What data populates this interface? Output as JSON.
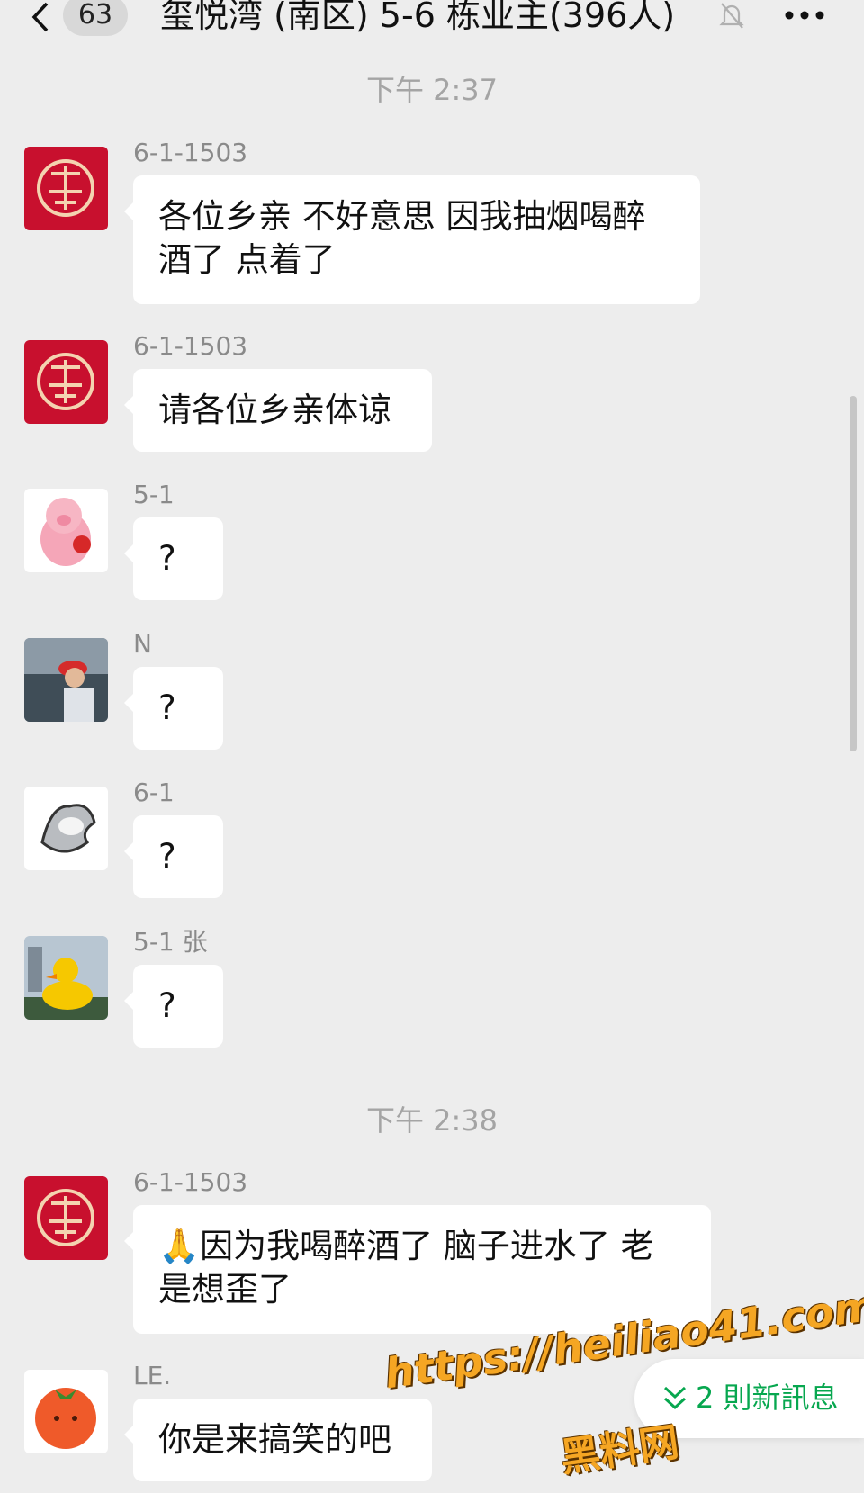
{
  "header": {
    "unread_count": "63",
    "title": "玺悦湾 (南区) 5-6 栋业主(396人)",
    "muted": true
  },
  "timestamps": [
    "下午 2:37",
    "下午 2:38"
  ],
  "messages": [
    {
      "sender": "6-1-1503",
      "text": "各位乡亲 不好意思 因我抽烟喝醉酒了 点着了",
      "avatar": "red-fu-avatar"
    },
    {
      "sender": "6-1-1503",
      "text": "请各位乡亲体谅",
      "avatar": "red-fu-avatar"
    },
    {
      "sender": "5-1",
      "text": "?",
      "avatar": "pink-pig-avatar"
    },
    {
      "sender": "N",
      "text": "?",
      "avatar": "person-red-cap-avatar"
    },
    {
      "sender": "6-1",
      "text": "?",
      "avatar": "silver-object-avatar"
    },
    {
      "sender": "5-1 张",
      "text": "?",
      "avatar": "rubber-duck-avatar"
    },
    {
      "sender": "6-1-1503",
      "text": "🙏因为我喝醉酒了 脑子进水了 老是想歪了",
      "avatar": "red-fu-avatar"
    },
    {
      "sender": "LE.",
      "text": "你是来搞笑的吧",
      "avatar": "tomato-avatar"
    }
  ],
  "new_messages_label": "2 則新訊息",
  "watermark": {
    "url": "https://heiliao41.com",
    "name": "黑料网"
  },
  "colors": {
    "background": "#ededed",
    "bubble": "#ffffff",
    "accent_green": "#07a74f",
    "watermark": "#f5a623"
  }
}
